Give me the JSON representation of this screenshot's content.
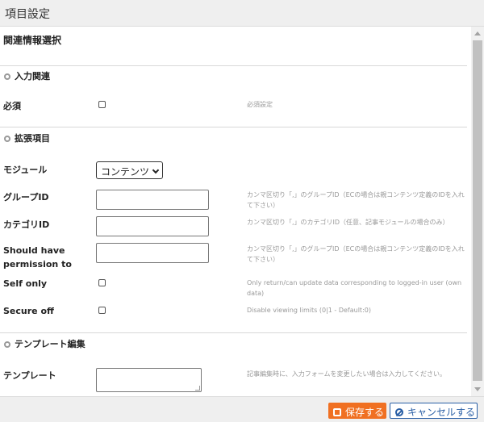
{
  "dialog": {
    "title": "項目設定"
  },
  "main_heading": "関連情報選択",
  "sections": {
    "input_related": "入力関連",
    "extended": "拡張項目",
    "template_edit": "テンプレート編集"
  },
  "fields": {
    "required": {
      "label": "必須",
      "checked": false,
      "note": "必須設定"
    },
    "module": {
      "label": "モジュール",
      "selected": "コンテンツ"
    },
    "group_id": {
      "label": "グループID",
      "value": "",
      "note": "カンマ区切り「,」のグループID（ECの場合は親コンテンツ定義のIDを入れて下さい）"
    },
    "category_id": {
      "label": "カテゴリID",
      "value": "",
      "note": "カンマ区切り「,」のカテゴリID（任意、記事モジュールの場合のみ）"
    },
    "permission": {
      "label_line1": "Should have",
      "label_line2": "permission to",
      "value": "",
      "note": "カンマ区切り「,」のグループID（ECの場合は親コンテンツ定義のIDを入れて下さい）"
    },
    "self_only": {
      "label": "Self only",
      "checked": false,
      "note": "Only return/can update data corresponding to logged-in user (own data)"
    },
    "secure_off": {
      "label": "Secure off",
      "checked": false,
      "note": "Disable viewing limits (0|1 - Default:0)"
    },
    "template": {
      "label": "テンプレート",
      "value": "",
      "note": "記事編集時に、入力フォームを変更したい場合は入力してください。"
    }
  },
  "footer": {
    "save_label": "保存する",
    "cancel_label": "キャンセルする"
  },
  "colors": {
    "save": "#f07022",
    "cancel": "#2a5fa5"
  }
}
